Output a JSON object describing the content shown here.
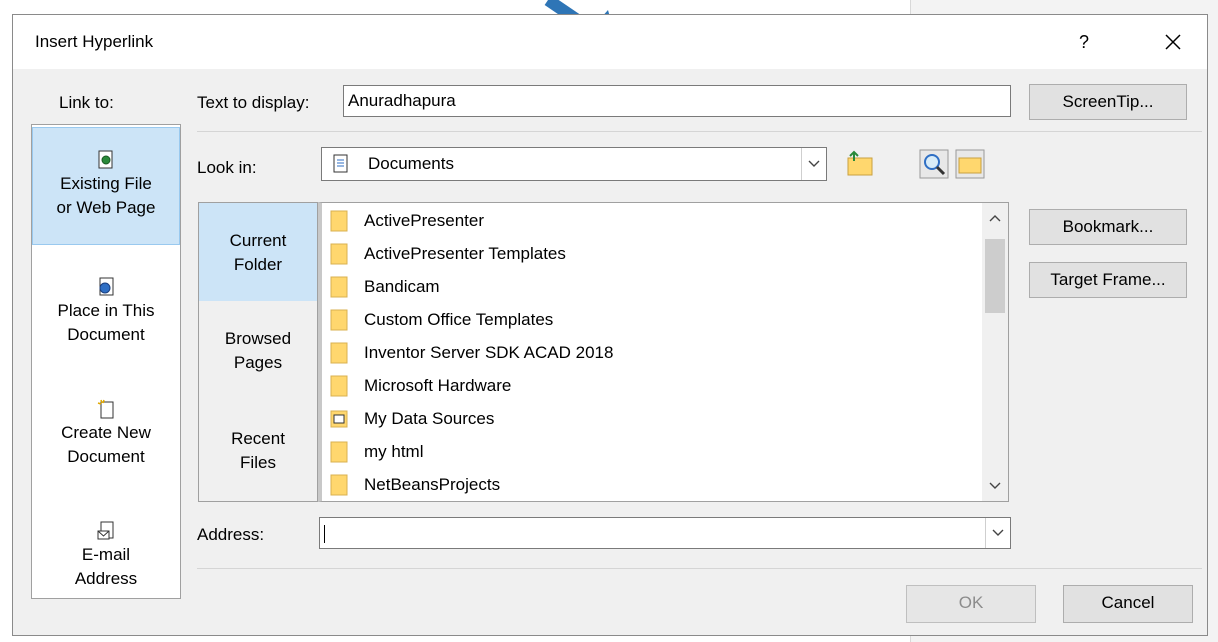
{
  "dialog": {
    "title": "Insert Hyperlink",
    "help": "?",
    "close": "✕"
  },
  "link_to": {
    "label": "Link to:",
    "items": [
      {
        "line1": "Existing File",
        "line2": "or Web Page",
        "icon": "existing-file-icon",
        "selected": true
      },
      {
        "line1": "Place in This",
        "line2": "Document",
        "icon": "place-in-document-icon",
        "selected": false
      },
      {
        "line1": "Create New",
        "line2": "Document",
        "icon": "create-new-document-icon",
        "selected": false
      },
      {
        "line1": "E-mail",
        "line2": "Address",
        "icon": "email-address-icon",
        "selected": false
      }
    ]
  },
  "text_to_display": {
    "label": "Text to display:",
    "value": "Anuradhapura"
  },
  "screentip_button": "ScreenTip...",
  "look_in": {
    "label": "Look in:",
    "value": "Documents"
  },
  "nav": [
    {
      "line1": "Current",
      "line2": "Folder",
      "selected": true
    },
    {
      "line1": "Browsed",
      "line2": "Pages",
      "selected": false
    },
    {
      "line1": "Recent",
      "line2": "Files",
      "selected": false
    }
  ],
  "files": [
    {
      "name": "ActivePresenter",
      "icon": "folder-icon"
    },
    {
      "name": "ActivePresenter Templates",
      "icon": "folder-icon"
    },
    {
      "name": "Bandicam",
      "icon": "folder-icon"
    },
    {
      "name": "Custom Office Templates",
      "icon": "folder-icon"
    },
    {
      "name": "Inventor Server SDK ACAD 2018",
      "icon": "folder-icon"
    },
    {
      "name": "Microsoft Hardware",
      "icon": "folder-icon"
    },
    {
      "name": "My Data Sources",
      "icon": "data-source-folder-icon"
    },
    {
      "name": "my html",
      "icon": "folder-icon"
    },
    {
      "name": "NetBeansProjects",
      "icon": "folder-icon"
    }
  ],
  "bookmark_button": "Bookmark...",
  "target_frame_button": "Target Frame...",
  "address": {
    "label": "Address:",
    "value": ""
  },
  "ok_button": "OK",
  "cancel_button": "Cancel",
  "colors": {
    "selection": "#cce4f7",
    "arrow": "#2e75b6",
    "folder": "#ffd76e"
  }
}
